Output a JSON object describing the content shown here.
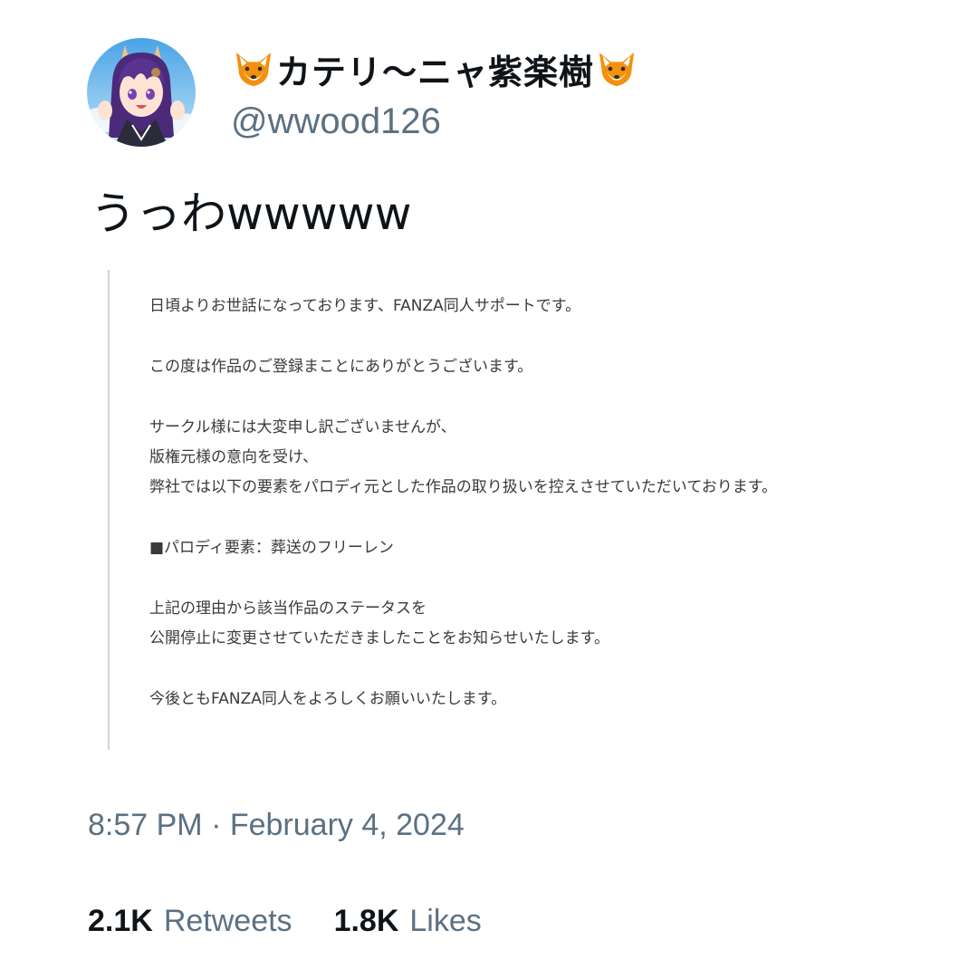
{
  "author": {
    "display_name_prefix_icon": "fox-face-icon",
    "display_name": "カテリ～ニャ紫楽樹",
    "display_name_suffix_icon": "fox-face-icon",
    "handle": "@wwood126",
    "avatar": "avatar-illustration"
  },
  "tweet": {
    "text": "うっわwwwww"
  },
  "attached_notice": {
    "paragraphs": [
      [
        "日頃よりお世話になっております、FANZA同人サポートです。"
      ],
      [
        "この度は作品のご登録まことにありがとうございます。"
      ],
      [
        "サークル様には大変申し訳ございませんが、",
        "版権元様の意向を受け、",
        "弊社では以下の要素をパロディ元とした作品の取り扱いを控えさせていただいております。"
      ],
      [
        "■パロディ要素：葬送のフリーレン"
      ],
      [
        "上記の理由から該当作品のステータスを",
        "公開停止に変更させていただきましたことをお知らせいたします。"
      ],
      [
        "今後ともFANZA同人をよろしくお願いいたします。"
      ]
    ]
  },
  "meta": {
    "timestamp": "8:57 PM · February 4, 2024"
  },
  "stats": {
    "retweets_count": "2.1K",
    "retweets_label": "Retweets",
    "likes_count": "1.8K",
    "likes_label": "Likes"
  },
  "colors": {
    "text": "#0f1419",
    "secondary_text": "#5b7083",
    "quote_rule": "#d4d4d4",
    "fox_orange": "#f4900c"
  }
}
